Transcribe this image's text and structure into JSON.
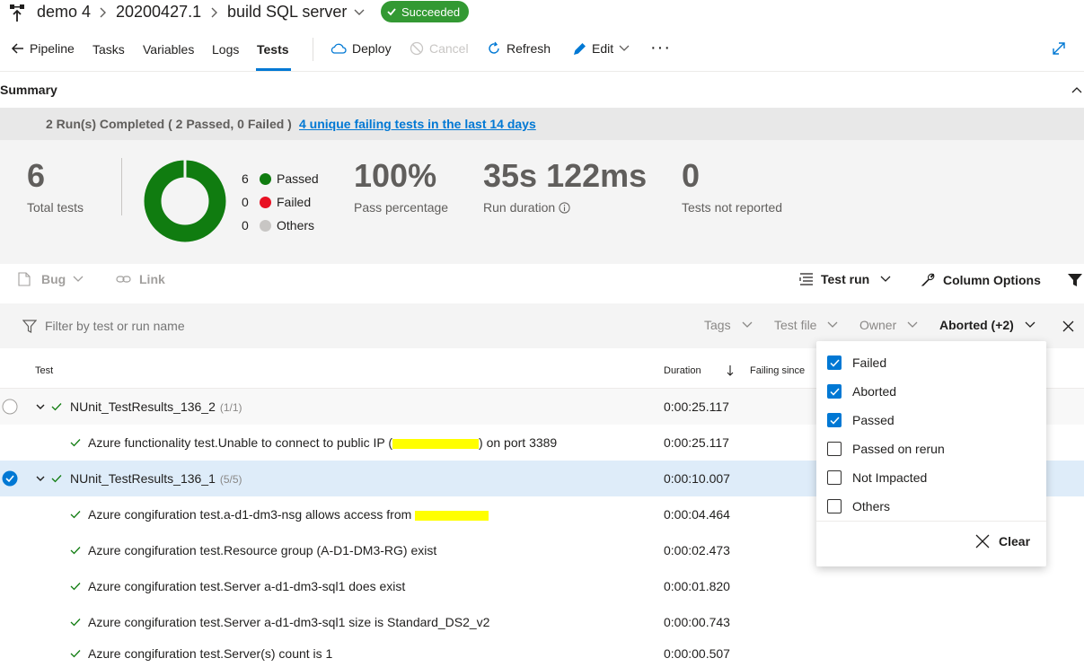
{
  "colors": {
    "accent": "#0078d4",
    "success": "#339933",
    "passed": "#107c10",
    "failed": "#e81123",
    "others": "#c8c6c4"
  },
  "header": {
    "crumbs": [
      "demo 4",
      "20200427.1",
      "build SQL server"
    ],
    "status": "Succeeded"
  },
  "nav": {
    "pipeline": "Pipeline",
    "tabs": [
      "Tasks",
      "Variables",
      "Logs",
      "Tests"
    ],
    "active_tab": "Tests",
    "deploy": "Deploy",
    "cancel": "Cancel",
    "refresh": "Refresh",
    "edit": "Edit",
    "more": "···"
  },
  "summary": {
    "title": "Summary",
    "runs_text": "2 Run(s) Completed ( 2 Passed, 0 Failed )",
    "failing_link": "4 unique failing tests in the last 14 days",
    "total_tests": "6",
    "total_label": "Total tests",
    "legend": [
      {
        "count": "6",
        "label": "Passed"
      },
      {
        "count": "0",
        "label": "Failed"
      },
      {
        "count": "0",
        "label": "Others"
      }
    ],
    "pass_pct": "100%",
    "pass_pct_label": "Pass percentage",
    "duration": "35s 122ms",
    "duration_label": "Run duration",
    "not_reported": "0",
    "not_reported_label": "Tests not reported"
  },
  "chart_data": {
    "type": "pie",
    "categories": [
      "Passed",
      "Failed",
      "Others"
    ],
    "values": [
      6,
      0,
      0
    ]
  },
  "toolbar": {
    "bug": "Bug",
    "link": "Link",
    "test_run": "Test run",
    "column_options": "Column Options"
  },
  "filter": {
    "placeholder": "Filter by test or run name",
    "tags": "Tags",
    "test_file": "Test file",
    "owner": "Owner",
    "outcome": "Aborted (+2)"
  },
  "table": {
    "col_test": "Test",
    "col_duration": "Duration",
    "col_failing": "Failing since",
    "rows": [
      {
        "name": "NUnit_TestResults_136_2",
        "count": "(1/1)",
        "duration": "0:00:25.117"
      },
      {
        "pre": "Azure functionality test.Unable to connect to public IP (",
        "post": ") on port 3389",
        "duration": "0:00:25.117"
      },
      {
        "name": "NUnit_TestResults_136_1",
        "count": "(5/5)",
        "duration": "0:00:10.007"
      },
      {
        "pre": "Azure congifuration test.a-d1-dm3-nsg allows access from",
        "duration": "0:00:04.464"
      },
      {
        "name": "Azure congifuration test.Resource group (A-D1-DM3-RG) exist",
        "duration": "0:00:02.473"
      },
      {
        "name": "Azure congifuration test.Server a-d1-dm3-sql1 does exist",
        "duration": "0:00:01.820"
      },
      {
        "name": "Azure congifuration test.Server a-d1-dm3-sql1 size is Standard_DS2_v2",
        "duration": "0:00:00.743"
      },
      {
        "name": "Azure congifuration test.Server(s) count is 1",
        "duration": "0:00:00.507"
      }
    ]
  },
  "dropdown": {
    "options": [
      {
        "label": "Failed",
        "checked": true
      },
      {
        "label": "Aborted",
        "checked": true
      },
      {
        "label": "Passed",
        "checked": true
      },
      {
        "label": "Passed on rerun",
        "checked": false
      },
      {
        "label": "Not Impacted",
        "checked": false
      },
      {
        "label": "Others",
        "checked": false
      }
    ],
    "clear": "Clear"
  }
}
